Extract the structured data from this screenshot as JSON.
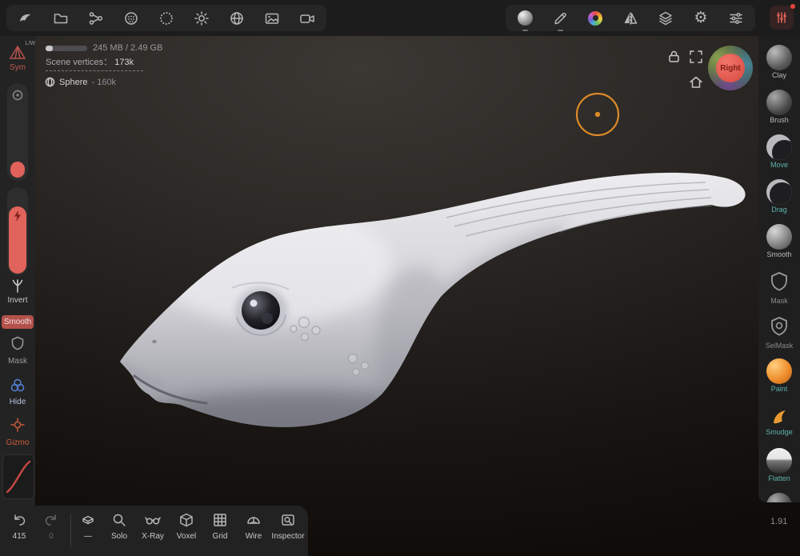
{
  "topbar": {
    "left_icons": [
      "app-logo",
      "files-folder",
      "scene-graph",
      "remesh-sphere",
      "stroke-dotted-circle",
      "lighting-sun",
      "material-globe",
      "background-image",
      "camera"
    ],
    "right_icons": [
      "matcap-sphere",
      "pencil",
      "color-wheel",
      "symmetry-mirror",
      "layers",
      "settings-gear",
      "interface-sliders",
      "history-grid"
    ]
  },
  "stats": {
    "memory": "245 MB / 2.49 GB",
    "vertices_label": "Scene vertices：",
    "vertices_value": "173k",
    "object_name": "Sphere",
    "object_detail": "- 160k"
  },
  "viewcube": {
    "face_label": "Right"
  },
  "left_toolbar": {
    "sym": "Sym",
    "sym_mode": "L/W",
    "invert": "Invert",
    "smooth": "Smooth",
    "mask": "Mask",
    "hide": "Hide",
    "gizmo": "Gizmo"
  },
  "right_toolbar": {
    "tools": [
      {
        "label": "Clay"
      },
      {
        "label": "Brush"
      },
      {
        "label": "Move"
      },
      {
        "label": "Drag"
      },
      {
        "label": "Smooth"
      },
      {
        "label": "Mask"
      },
      {
        "label": "SelMask"
      },
      {
        "label": "Paint"
      },
      {
        "label": "Smudge"
      },
      {
        "label": "Flatten"
      },
      {
        "label": ""
      }
    ]
  },
  "bottom_bar": {
    "undo_count": "415",
    "redo_count": "0",
    "layers_value": "—",
    "solo": "Solo",
    "xray": "X-Ray",
    "voxel": "Voxel",
    "grid": "Grid",
    "wire": "Wire",
    "inspector": "Inspector"
  },
  "footer": {
    "version": "1.91"
  },
  "colors": {
    "accent_teal": "#5fb3ad",
    "accent_red": "#e0625a",
    "accent_orange": "#dd8a28",
    "viewcube_face": "#e25449"
  }
}
